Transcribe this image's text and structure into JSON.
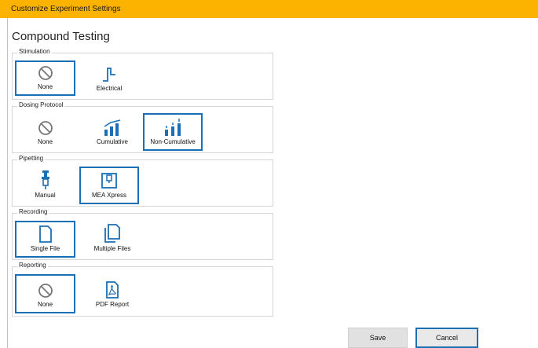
{
  "window": {
    "title": "Customize Experiment Settings"
  },
  "page": {
    "title": "Compound Testing"
  },
  "groups": {
    "stimulation": {
      "label": "Stimulation",
      "options": [
        {
          "label": "None",
          "icon": "none-icon"
        },
        {
          "label": "Electrical",
          "icon": "pulse-icon"
        }
      ],
      "selected": "None"
    },
    "dosing": {
      "label": "Dosing Protocol",
      "options": [
        {
          "label": "None",
          "icon": "none-icon"
        },
        {
          "label": "Cumulative",
          "icon": "cumulative-icon"
        },
        {
          "label": "Non-Cumulative",
          "icon": "non-cumulative-icon"
        }
      ],
      "selected": "Non-Cumulative"
    },
    "pipetting": {
      "label": "Pipetting",
      "options": [
        {
          "label": "Manual",
          "icon": "pipette-icon"
        },
        {
          "label": "MEA Xpress",
          "icon": "mea-xpress-icon"
        }
      ],
      "selected": "MEA Xpress"
    },
    "recording": {
      "label": "Recording",
      "options": [
        {
          "label": "Single File",
          "icon": "file-icon"
        },
        {
          "label": "Multiple Files",
          "icon": "files-icon"
        }
      ],
      "selected": "Single File"
    },
    "reporting": {
      "label": "Reporting",
      "options": [
        {
          "label": "None",
          "icon": "none-icon"
        },
        {
          "label": "PDF Report",
          "icon": "pdf-icon"
        }
      ],
      "selected": "None"
    }
  },
  "footer": {
    "save_label": "Save",
    "cancel_label": "Cancel"
  },
  "colors": {
    "titlebar": "#fbb300",
    "accent": "#1a6fb5"
  }
}
